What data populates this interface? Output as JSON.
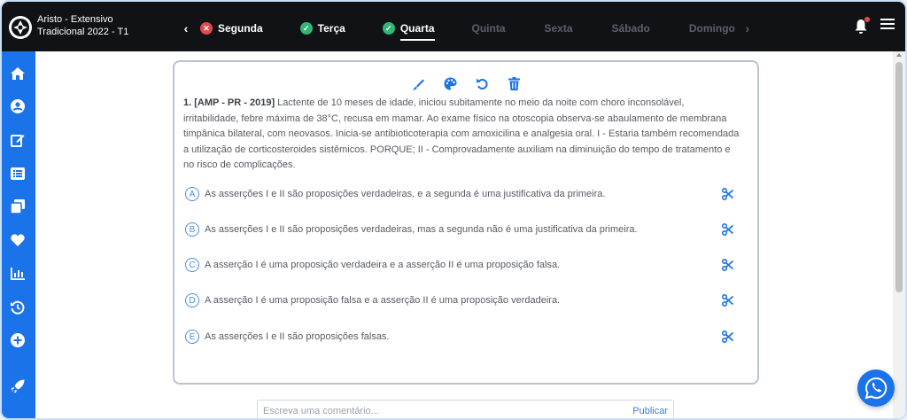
{
  "app": {
    "title_line1": "Aristo - Extensivo",
    "title_line2": "Tradicional 2022 - T1"
  },
  "days": [
    {
      "label": "Segunda",
      "status": "wrong"
    },
    {
      "label": "Terça",
      "status": "done"
    },
    {
      "label": "Quarta",
      "status": "done",
      "active": true
    },
    {
      "label": "Quinta",
      "status": "future"
    },
    {
      "label": "Sexta",
      "status": "future"
    },
    {
      "label": "Sábado",
      "status": "future"
    },
    {
      "label": "Domingo",
      "status": "future"
    }
  ],
  "nav": {
    "prev": "‹",
    "next": "›"
  },
  "sidebar_icons": [
    "home-icon",
    "user-icon",
    "edit-icon",
    "list-icon",
    "cards-icon",
    "heart-icon",
    "chart-icon",
    "history-icon",
    "plus-icon",
    "rocket-icon"
  ],
  "toolbar_icons": [
    "highlighter-icon",
    "palette-icon",
    "undo-icon",
    "trash-icon"
  ],
  "question": {
    "header": "1. [AMP - PR - 2019]",
    "text": " Lactente de 10 meses de idade, iniciou subitamente no meio da noite com choro inconsolável, irritabilidade, febre máxima de 38°C, recusa em mamar. Ao exame físico na otoscopia observa-se abaulamento de membrana timpânica bilateral, com neovasos. Inicia-se antibioticoterapia com amoxicilina e analgesia oral. I - Estaria também recomendada a utilização de corticosteroides sistêmicos. PORQUE; II - Comprovadamente auxiliam na diminuição do tempo de tratamento e no risco de complicações."
  },
  "options": [
    {
      "letter": "A",
      "text": "As asserções I e II são proposições verdadeiras, e a segunda é uma justificativa da primeira."
    },
    {
      "letter": "B",
      "text": "As asserções I e II são proposições verdadeiras, mas a segunda não é uma justificativa da primeira."
    },
    {
      "letter": "C",
      "text": "A asserção I é uma proposição verdadeira e a asserção II é uma proposição falsa."
    },
    {
      "letter": "D",
      "text": "A asserção I é uma proposição falsa e a asserção II é uma proposição verdadeira."
    },
    {
      "letter": "E",
      "text": "As asserções I e II são proposições falsas."
    }
  ],
  "comment": {
    "placeholder": "Escreva uma comentário...",
    "publish_label": "Publicar"
  },
  "colors": {
    "accent": "#1a73e8",
    "topbar": "#101216",
    "correct": "#2fb877",
    "wrong": "#e24a4a"
  }
}
